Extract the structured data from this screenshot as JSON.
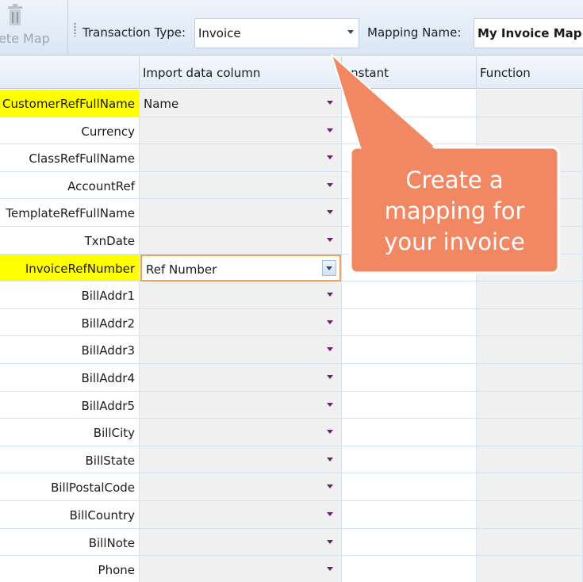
{
  "toolbar": {
    "delete_map_label": "ete Map",
    "transaction_type_label": "Transaction Type:",
    "transaction_type_value": "Invoice",
    "mapping_name_label": "Mapping Name:",
    "mapping_name_value": "My Invoice Map"
  },
  "grid": {
    "headers": {
      "import_column": "Import data column",
      "constant": "onstant",
      "function": "Function"
    },
    "rows": [
      {
        "field": "CustomerRefFullName",
        "import": "Name",
        "required": true
      },
      {
        "field": "Currency",
        "import": "",
        "required": false
      },
      {
        "field": "ClassRefFullName",
        "import": "",
        "required": false
      },
      {
        "field": "AccountRef",
        "import": "",
        "required": false
      },
      {
        "field": "TemplateRefFullName",
        "import": "",
        "required": false
      },
      {
        "field": "TxnDate",
        "import": "",
        "required": false
      },
      {
        "field": "InvoiceRefNumber",
        "import": "Ref Number",
        "required": true,
        "active": true
      },
      {
        "field": "BillAddr1",
        "import": "",
        "required": false
      },
      {
        "field": "BillAddr2",
        "import": "",
        "required": false
      },
      {
        "field": "BillAddr3",
        "import": "",
        "required": false
      },
      {
        "field": "BillAddr4",
        "import": "",
        "required": false
      },
      {
        "field": "BillAddr5",
        "import": "",
        "required": false
      },
      {
        "field": "BillCity",
        "import": "",
        "required": false
      },
      {
        "field": "BillState",
        "import": "",
        "required": false
      },
      {
        "field": "BillPostalCode",
        "import": "",
        "required": false
      },
      {
        "field": "BillCountry",
        "import": "",
        "required": false
      },
      {
        "field": "BillNote",
        "import": "",
        "required": false
      },
      {
        "field": "Phone",
        "import": "",
        "required": false
      }
    ]
  },
  "callout": {
    "lines": [
      "Create a",
      "mapping for",
      "your invoice"
    ],
    "fill_color": "#f28863",
    "border_color": "#ffffff"
  },
  "colors": {
    "required_highlight": "#ffff00",
    "active_cell_border": "#f0a058",
    "dropdown_arrow": "#6d1f72"
  },
  "icons": {
    "delete": "trash-icon",
    "dropdown": "chevron-down-icon",
    "grip": "toolbar-grip-icon"
  }
}
